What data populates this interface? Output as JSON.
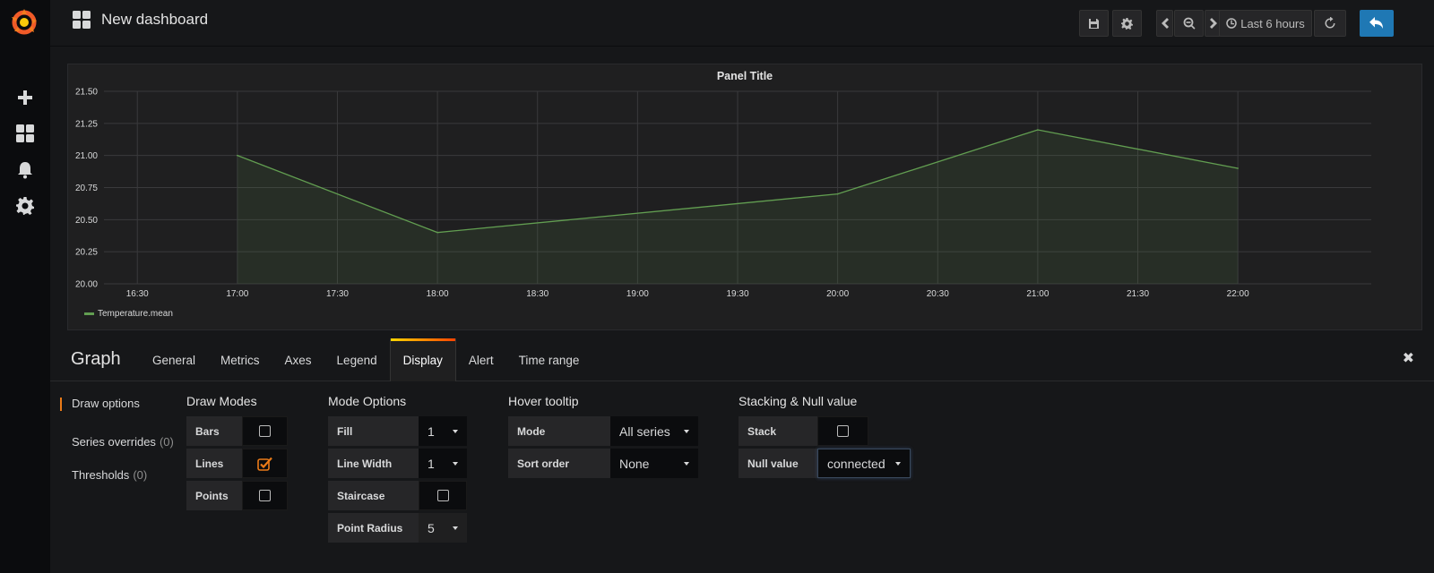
{
  "header": {
    "dashboard_title": "New dashboard",
    "time_range": "Last 6 hours"
  },
  "panel": {
    "title": "Panel Title",
    "legend": "Temperature.mean",
    "series_color": "#629e51"
  },
  "chart_data": {
    "type": "area",
    "title": "Panel Title",
    "xlabel": "",
    "ylabel": "",
    "x_ticks": [
      "16:30",
      "17:00",
      "17:30",
      "18:00",
      "18:30",
      "19:00",
      "19:30",
      "20:00",
      "20:30",
      "21:00",
      "21:30",
      "22:00"
    ],
    "y_ticks": [
      "20.00",
      "20.25",
      "20.50",
      "20.75",
      "21.00",
      "21.25",
      "21.50"
    ],
    "ylim": [
      20.0,
      21.5
    ],
    "xlim": [
      "16:20",
      "22:40"
    ],
    "grid": true,
    "legend_position": "bottom-left",
    "series": [
      {
        "name": "Temperature.mean",
        "x": [
          "17:00",
          "18:00",
          "20:00",
          "21:00",
          "22:00"
        ],
        "values": [
          21.0,
          20.4,
          20.7,
          21.2,
          20.9
        ]
      }
    ]
  },
  "editor": {
    "title": "Graph",
    "tabs": [
      "General",
      "Metrics",
      "Axes",
      "Legend",
      "Display",
      "Alert",
      "Time range"
    ],
    "active_tab": "Display",
    "subnav": [
      {
        "label": "Draw options",
        "count": ""
      },
      {
        "label": "Series overrides",
        "count": "(0)"
      },
      {
        "label": "Thresholds",
        "count": "(0)"
      }
    ],
    "draw_modes": {
      "title": "Draw Modes",
      "bars": "Bars",
      "lines": "Lines",
      "points": "Points",
      "bars_checked": false,
      "lines_checked": true,
      "points_checked": false
    },
    "mode_options": {
      "title": "Mode Options",
      "fill_label": "Fill",
      "fill_value": "1",
      "line_width_label": "Line Width",
      "line_width_value": "1",
      "staircase_label": "Staircase",
      "point_radius_label": "Point Radius",
      "point_radius_value": "5"
    },
    "hover_tooltip": {
      "title": "Hover tooltip",
      "mode_label": "Mode",
      "mode_value": "All series",
      "sort_label": "Sort order",
      "sort_value": "None"
    },
    "stacking": {
      "title": "Stacking & Null value",
      "stack_label": "Stack",
      "null_label": "Null value",
      "null_value": "connected"
    }
  }
}
